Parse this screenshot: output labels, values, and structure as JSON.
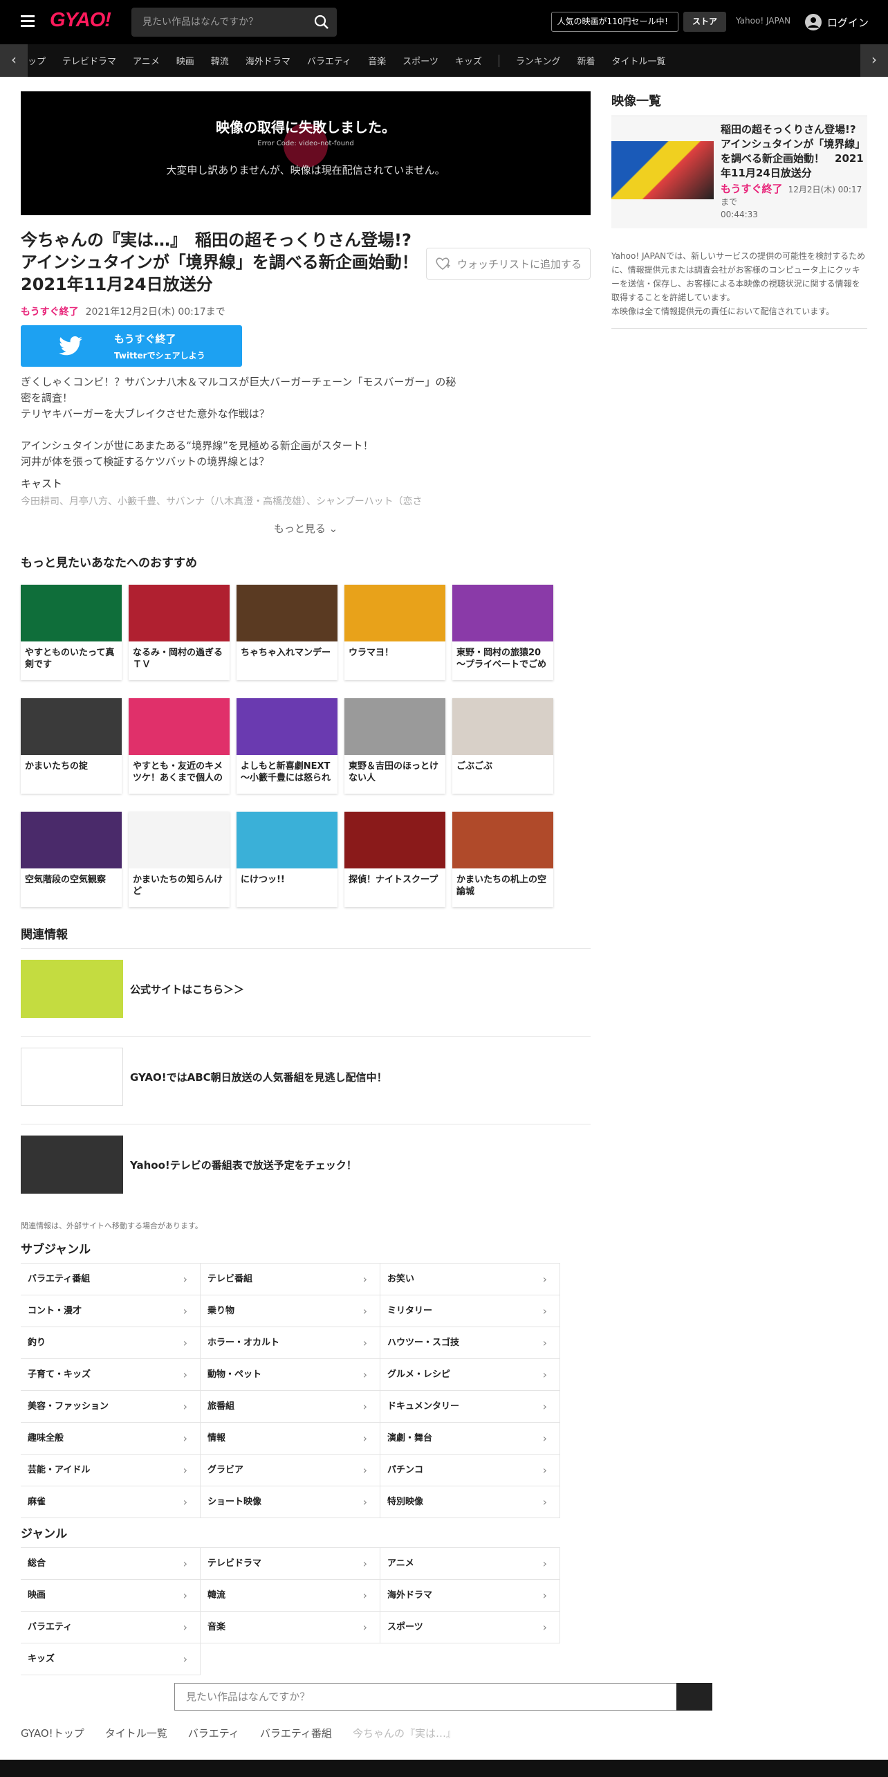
{
  "header": {
    "logo": "GYAO!",
    "search_placeholder": "見たい作品はなんですか？",
    "promo": "人気の映画が110円セール中！",
    "store": "ストア",
    "yahoo": "Yahoo! JAPAN",
    "login": "ログイン"
  },
  "nav": {
    "items": [
      "ップ",
      "テレビドラマ",
      "アニメ",
      "映画",
      "韓流",
      "海外ドラマ",
      "バラエティ",
      "音楽",
      "スポーツ",
      "キッズ"
    ],
    "items2": [
      "ランキング",
      "新着",
      "タイトル一覧"
    ],
    "prev": "‹",
    "next": "›"
  },
  "player": {
    "error_title": "映像の取得に失敗しました。",
    "error_code": "Error Code: video-not-found",
    "error_msg": "大変申し訳ありませんが、映像は現在配信されていません。"
  },
  "episode": {
    "title": "今ちゃんの『実は…』　稲田の超そっくりさん登場!?アインシュタインが「境界線」を調べる新企画始動！　2021年11月24日放送分",
    "watchlist": "ウォッチリストに追加する",
    "expiring": "もうすぐ終了",
    "until": "2021年12月2日(木) 00:17まで",
    "description": "ぎくしゃくコンビ！？サバンナ八木＆マルコスが巨大バーガーチェーン「モスバーガー」の秘密を調査！\nテリヤキバーガーを大ブレイクさせた意外な作戦は？\n\nアインシュタインが世にあまたある“境界線”を見極める新企画がスタート！\n河井が体を張って検証するケツバットの境界線とは？",
    "cast_label": "キャスト",
    "cast": "今田耕司、月亭八方、小籔千豊、サバンナ（八木真澄・高橋茂雄）、シャンプーハット（恋さ",
    "more": "もっと見る"
  },
  "twitter": {
    "line1": "もうすぐ終了",
    "line2": "Twitterでシェアしよう"
  },
  "recommend": {
    "heading": "もっと見たいあなたへのおすすめ",
    "items": [
      {
        "title": "やすとものいたって真剣です",
        "color": "#0f6e3a"
      },
      {
        "title": "なるみ・岡村の過ぎるＴＶ",
        "color": "#b02030"
      },
      {
        "title": "ちゃちゃ入れマンデー",
        "color": "#5a3a22"
      },
      {
        "title": "ウラマヨ！",
        "color": "#e8a21a"
      },
      {
        "title": "東野・岡村の旅猿20～プライベートでごめ",
        "color": "#8a3aa8"
      },
      {
        "title": "かまいたちの掟",
        "color": "#3a3a3a"
      },
      {
        "title": "やすとも・友近のキメツケ！あくまで個人の",
        "color": "#e0306a"
      },
      {
        "title": "よしもと新喜劇NEXT～小籔千豊には怒られ",
        "color": "#6a3ab0"
      },
      {
        "title": "東野＆吉田のほっとけない人",
        "color": "#9a9a9a"
      },
      {
        "title": "ごぶごぶ",
        "color": "#d8d0c8"
      },
      {
        "title": "空気階段の空気観察",
        "color": "#4a2a6a"
      },
      {
        "title": "かまいたちの知らんけど",
        "color": "#f4f4f4"
      },
      {
        "title": "にけつッ!!",
        "color": "#3ab0d8"
      },
      {
        "title": "探偵！ナイトスクープ",
        "color": "#8a1a1a"
      },
      {
        "title": "かまいたちの机上の空論城",
        "color": "#b04a2a"
      }
    ]
  },
  "related": {
    "heading": "関連情報",
    "items": [
      {
        "title": "公式サイトはこちら＞＞",
        "color": "#c4dc40"
      },
      {
        "title": "GYAO!ではABC朝日放送の人気番組を見逃し配信中！",
        "color": "#ffffff"
      },
      {
        "title": "Yahoo!テレビの番組表で放送予定をチェック！",
        "color": "#333333"
      }
    ],
    "note": "関連情報は、外部サイトへ移動する場合があります。"
  },
  "subgenre": {
    "heading": "サブジャンル",
    "items": [
      "バラエティ番組",
      "テレビ番組",
      "お笑い",
      "コント・漫才",
      "乗り物",
      "ミリタリー",
      "釣り",
      "ホラー・オカルト",
      "ハウツー・スゴ技",
      "子育て・キッズ",
      "動物・ペット",
      "グルメ・レシピ",
      "美容・ファッション",
      "旅番組",
      "ドキュメンタリー",
      "趣味全般",
      "情報",
      "演劇・舞台",
      "芸能・アイドル",
      "グラビア",
      "パチンコ",
      "麻雀",
      "ショート映像",
      "特別映像"
    ]
  },
  "genre": {
    "heading": "ジャンル",
    "items": [
      "総合",
      "テレビドラマ",
      "アニメ",
      "映画",
      "韓流",
      "海外ドラマ",
      "バラエティ",
      "音楽",
      "スポーツ",
      "キッズ"
    ]
  },
  "sidebar": {
    "heading": "映像一覧",
    "item": {
      "title": "稲田の超そっくりさん登場!?アインシュタインが「境界線」を調べる新企画始動！　2021年11月24日放送分",
      "badge": "もうすぐ終了",
      "until": "12月2日(木) 00:17まで",
      "duration": "00:44:33"
    },
    "notice": "Yahoo! JAPANでは、新しいサービスの提供の可能性を検討するために、情報提供元または調査会社がお客様のコンピュータ上にクッキーを送信・保存し、お客様による本映像の視聴状況に関する情報を取得することを許諾しています。\n本映像は全て情報提供元の責任において配信されています。"
  },
  "bottom": {
    "search_placeholder": "見たい作品はなんですか？",
    "breadcrumb": [
      "GYAO!トップ",
      "タイトル一覧",
      "バラエティ",
      "バラエティ番組",
      "今ちゃんの『実は…』"
    ]
  },
  "colors": {
    "brand": "#ff1a5c",
    "expiring": "#e8257a",
    "twitter": "#1da1f2"
  }
}
